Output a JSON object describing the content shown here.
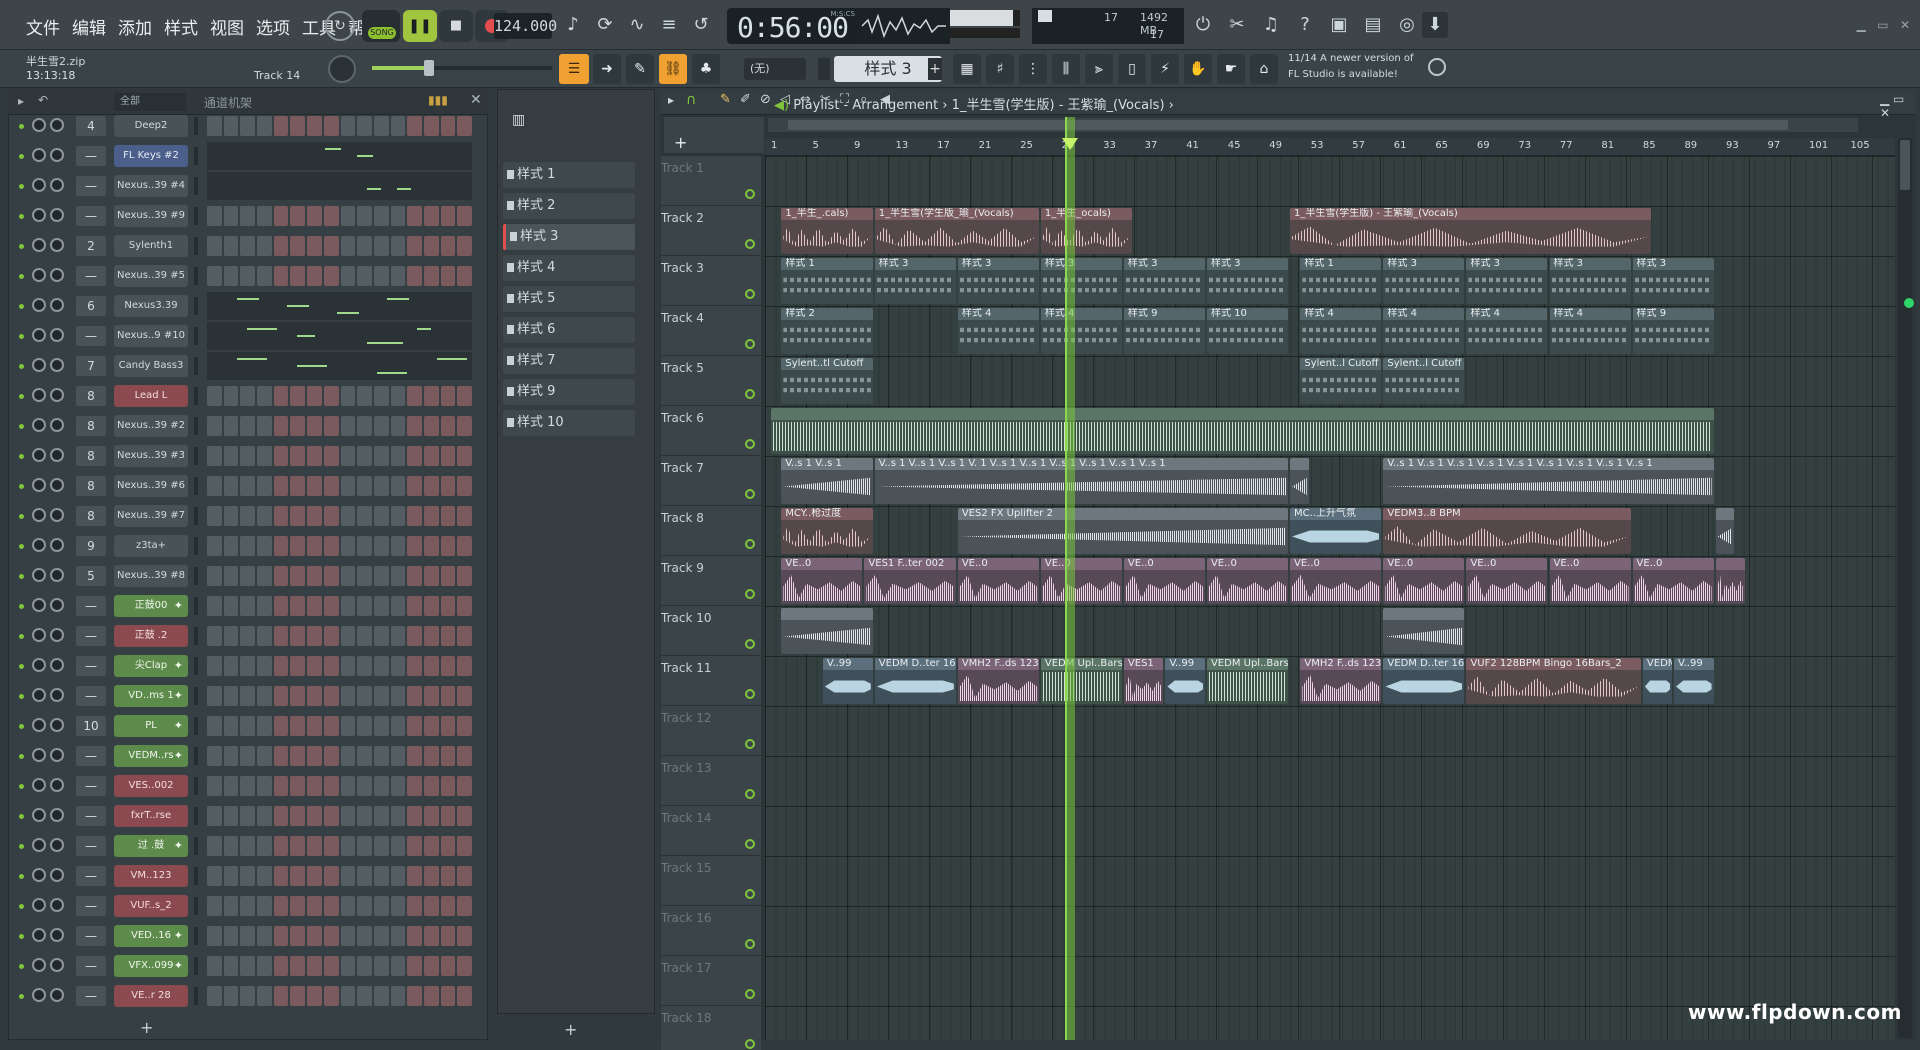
{
  "menu": [
    "文件",
    "编辑",
    "添加",
    "样式",
    "视图",
    "选项",
    "工具",
    "帮助"
  ],
  "transport": {
    "song_label": "SONG",
    "tempo": "124.000",
    "time": "0:56:00",
    "time_unit": "M:S:CS",
    "cpu_value": "17",
    "memory": "1492 MB",
    "polyphony": "17"
  },
  "project": {
    "file": "半生雪2.zip",
    "time": "13:13:18",
    "track_hint": "Track 14"
  },
  "toolbar2": {
    "preset": "(无)",
    "pattern": "样式 3"
  },
  "news": {
    "line1": "11/14  A newer version of",
    "line2": "FL Studio is available!"
  },
  "rack": {
    "filter": "全部",
    "title": "通道机架",
    "channels": [
      {
        "num": "4",
        "name": "Deep2",
        "style": "plain"
      },
      {
        "num": "—",
        "name": "FL Keys #2",
        "style": "blue"
      },
      {
        "num": "—",
        "name": "Nexus..39 #4",
        "style": "plain"
      },
      {
        "num": "—",
        "name": "Nexus..39 #9",
        "style": "plain"
      },
      {
        "num": "2",
        "name": "Sylenth1",
        "style": "plain"
      },
      {
        "num": "—",
        "name": "Nexus..39 #5",
        "style": "plain"
      },
      {
        "num": "6",
        "name": "Nexus3.39",
        "style": "plain"
      },
      {
        "num": "—",
        "name": "Nexus..9 #10",
        "style": "plain"
      },
      {
        "num": "7",
        "name": "Candy Bass3",
        "style": "plain"
      },
      {
        "num": "8",
        "name": "Lead L",
        "style": "red"
      },
      {
        "num": "8",
        "name": "Nexus..39 #2",
        "style": "plain"
      },
      {
        "num": "8",
        "name": "Nexus..39 #3",
        "style": "plain"
      },
      {
        "num": "8",
        "name": "Nexus..39 #6",
        "style": "plain"
      },
      {
        "num": "8",
        "name": "Nexus..39 #7",
        "style": "plain"
      },
      {
        "num": "9",
        "name": "z3ta+",
        "style": "plain"
      },
      {
        "num": "5",
        "name": "Nexus..39 #8",
        "style": "plain"
      },
      {
        "num": "—",
        "name": "正鼓00",
        "style": "green"
      },
      {
        "num": "—",
        "name": "正鼓 .2",
        "style": "red"
      },
      {
        "num": "—",
        "name": "尖Clap",
        "style": "green"
      },
      {
        "num": "—",
        "name": "VD..ms 1",
        "style": "green"
      },
      {
        "num": "10",
        "name": "PL",
        "style": "green"
      },
      {
        "num": "—",
        "name": "VEDM..rs",
        "style": "green"
      },
      {
        "num": "—",
        "name": "VES..002",
        "style": "red"
      },
      {
        "num": "—",
        "name": "fxrT..rse",
        "style": "red"
      },
      {
        "num": "—",
        "name": "过 .鼓",
        "style": "green"
      },
      {
        "num": "—",
        "name": "VM..123",
        "style": "red"
      },
      {
        "num": "—",
        "name": "VUF..s_2",
        "style": "red"
      },
      {
        "num": "—",
        "name": "VED..16",
        "style": "green"
      },
      {
        "num": "—",
        "name": "VFX..099",
        "style": "green"
      },
      {
        "num": "—",
        "name": "VE..r 28",
        "style": "red"
      }
    ]
  },
  "patterns": [
    "样式 1",
    "样式 2",
    "样式 3",
    "样式 4",
    "样式 5",
    "样式 6",
    "样式 7",
    "样式 9",
    "样式 10"
  ],
  "playlist": {
    "title": "Playlist - Arrangement",
    "breadcrumb": "1_半生雪(学生版) - 王紫瑜_(Vocals)",
    "bars": [
      "1",
      "5",
      "9",
      "13",
      "17",
      "21",
      "25",
      "29",
      "33",
      "37",
      "41",
      "45",
      "49",
      "53",
      "57",
      "61",
      "65",
      "69",
      "73",
      "77",
      "81",
      "85",
      "89",
      "93",
      "97",
      "101",
      "105"
    ],
    "tracks": [
      "Track 1",
      "Track 2",
      "Track 3",
      "Track 4",
      "Track 5",
      "Track 6",
      "Track 7",
      "Track 8",
      "Track 9",
      "Track 10",
      "Track 11",
      "Track 12",
      "Track 13",
      "Track 14",
      "Track 15",
      "Track 16",
      "Track 17",
      "Track 18"
    ]
  },
  "clips": [
    {
      "track": 1,
      "start": 1,
      "len": 9,
      "label": "1_半生_.cals)",
      "kind": "audio-r"
    },
    {
      "track": 1,
      "start": 10,
      "len": 16,
      "label": "1_半生雪(学生版_瑜_(Vocals)",
      "kind": "audio-r"
    },
    {
      "track": 1,
      "start": 26,
      "len": 9,
      "label": "1_半生_ocals)",
      "kind": "audio-r"
    },
    {
      "track": 1,
      "start": 50,
      "len": 35,
      "label": "1_半生雪(学生版) - 王紫瑜_(Vocals)",
      "kind": "audio-r"
    },
    {
      "track": 2,
      "start": 1,
      "len": 9,
      "label": "样式 1",
      "kind": "pattern-c"
    },
    {
      "track": 2,
      "start": 10,
      "len": 8,
      "label": "样式 3",
      "kind": "pattern-c"
    },
    {
      "track": 2,
      "start": 18,
      "len": 8,
      "label": "样式 3",
      "kind": "pattern-c"
    },
    {
      "track": 2,
      "start": 26,
      "len": 8,
      "label": "样式 3",
      "kind": "pattern-c"
    },
    {
      "track": 2,
      "start": 34,
      "len": 8,
      "label": "样式 3",
      "kind": "pattern-c"
    },
    {
      "track": 2,
      "start": 42,
      "len": 8,
      "label": "样式 3",
      "kind": "pattern-c"
    },
    {
      "track": 2,
      "start": 51,
      "len": 8,
      "label": "样式 1",
      "kind": "pattern-c"
    },
    {
      "track": 2,
      "start": 59,
      "len": 8,
      "label": "样式 3",
      "kind": "pattern-c"
    },
    {
      "track": 2,
      "start": 67,
      "len": 8,
      "label": "样式 3",
      "kind": "pattern-c"
    },
    {
      "track": 2,
      "start": 75,
      "len": 8,
      "label": "样式 3",
      "kind": "pattern-c"
    },
    {
      "track": 2,
      "start": 83,
      "len": 8,
      "label": "样式 3",
      "kind": "pattern-c"
    },
    {
      "track": 3,
      "start": 1,
      "len": 9,
      "label": "样式 2",
      "kind": "pattern-c"
    },
    {
      "track": 3,
      "start": 18,
      "len": 8,
      "label": "样式 4",
      "kind": "pattern-c"
    },
    {
      "track": 3,
      "start": 26,
      "len": 8,
      "label": "样式 4",
      "kind": "pattern-c"
    },
    {
      "track": 3,
      "start": 34,
      "len": 8,
      "label": "样式 9",
      "kind": "pattern-c"
    },
    {
      "track": 3,
      "start": 42,
      "len": 8,
      "label": "样式 10",
      "kind": "pattern-c"
    },
    {
      "track": 3,
      "start": 51,
      "len": 8,
      "label": "样式 4",
      "kind": "pattern-c"
    },
    {
      "track": 3,
      "start": 59,
      "len": 8,
      "label": "样式 4",
      "kind": "pattern-c"
    },
    {
      "track": 3,
      "start": 67,
      "len": 8,
      "label": "样式 4",
      "kind": "pattern-c"
    },
    {
      "track": 3,
      "start": 75,
      "len": 8,
      "label": "样式 4",
      "kind": "pattern-c"
    },
    {
      "track": 3,
      "start": 83,
      "len": 8,
      "label": "样式 9",
      "kind": "pattern-c"
    },
    {
      "track": 4,
      "start": 1,
      "len": 9,
      "label": "Sylent..tl Cutoff",
      "kind": "pattern-c"
    },
    {
      "track": 4,
      "start": 51,
      "len": 8,
      "label": "Sylent..l Cutoff",
      "kind": "pattern-c"
    },
    {
      "track": 4,
      "start": 59,
      "len": 8,
      "label": "Sylent..l Cutoff",
      "kind": "pattern-c"
    },
    {
      "track": 5,
      "start": 0,
      "len": 91,
      "label": "",
      "kind": "audio-g"
    },
    {
      "track": 6,
      "start": 1,
      "len": 9,
      "label": "V..s 1  V..s 1",
      "kind": "audio-b"
    },
    {
      "track": 6,
      "start": 10,
      "len": 40,
      "label": "V..s 1  V..s 1  V..s 1  V. 1  V..s 1  V..s 1  V..s 1  V..s 1  V..s 1  V..s 1",
      "kind": "audio-b"
    },
    {
      "track": 6,
      "start": 50,
      "len": 2,
      "label": "",
      "kind": "audio-b"
    },
    {
      "track": 6,
      "start": 59,
      "len": 32,
      "label": "V..s 1  V..s 1  V..s 1  V..s 1  V..s 1  V..s 1  V..s 1  V..s 1  V..s 1",
      "kind": "audio-b"
    },
    {
      "track": 7,
      "start": 1,
      "len": 9,
      "label": "MCY..枪过度",
      "kind": "audio-r"
    },
    {
      "track": 7,
      "start": 18,
      "len": 32,
      "label": "VES2 FX Uplifter 2",
      "kind": "audio-b"
    },
    {
      "track": 7,
      "start": 50,
      "len": 9,
      "label": "MC..上升气氛",
      "kind": "audio-c"
    },
    {
      "track": 7,
      "start": 59,
      "len": 24,
      "label": "VEDM3..8 BPM",
      "kind": "audio-r"
    },
    {
      "track": 7,
      "start": 91,
      "len": 2,
      "label": "",
      "kind": "audio-b"
    },
    {
      "track": 8,
      "start": 1,
      "len": 8,
      "label": "VE..0",
      "kind": "audio-p"
    },
    {
      "track": 8,
      "start": 9,
      "len": 9,
      "label": "VES1 F..ter 002",
      "kind": "audio-p"
    },
    {
      "track": 8,
      "start": 18,
      "len": 8,
      "label": "VE..0",
      "kind": "audio-p"
    },
    {
      "track": 8,
      "start": 26,
      "len": 8,
      "label": "VE..0",
      "kind": "audio-p"
    },
    {
      "track": 8,
      "start": 34,
      "len": 8,
      "label": "VE..0",
      "kind": "audio-p"
    },
    {
      "track": 8,
      "start": 42,
      "len": 8,
      "label": "VE..0",
      "kind": "audio-p"
    },
    {
      "track": 8,
      "start": 50,
      "len": 9,
      "label": "VE..0",
      "kind": "audio-p"
    },
    {
      "track": 8,
      "start": 59,
      "len": 8,
      "label": "VE..0",
      "kind": "audio-p"
    },
    {
      "track": 8,
      "start": 67,
      "len": 8,
      "label": "VE..0",
      "kind": "audio-p"
    },
    {
      "track": 8,
      "start": 75,
      "len": 8,
      "label": "VE..0",
      "kind": "audio-p"
    },
    {
      "track": 8,
      "start": 83,
      "len": 8,
      "label": "VE..0",
      "kind": "audio-p"
    },
    {
      "track": 8,
      "start": 91,
      "len": 3,
      "label": "",
      "kind": "audio-p"
    },
    {
      "track": 9,
      "start": 1,
      "len": 9,
      "label": "",
      "kind": "audio-b"
    },
    {
      "track": 9,
      "start": 59,
      "len": 8,
      "label": "",
      "kind": "audio-b"
    },
    {
      "track": 10,
      "start": 5,
      "len": 5,
      "label": "V..99",
      "kind": "audio-c"
    },
    {
      "track": 10,
      "start": 10,
      "len": 8,
      "label": "VEDM D..ter 16",
      "kind": "audio-c"
    },
    {
      "track": 10,
      "start": 18,
      "len": 8,
      "label": "VMH2 F..ds 123",
      "kind": "audio-p"
    },
    {
      "track": 10,
      "start": 26,
      "len": 8,
      "label": "VEDM Upl..Bars",
      "kind": "audio-g"
    },
    {
      "track": 10,
      "start": 34,
      "len": 4,
      "label": "VES1",
      "kind": "audio-p"
    },
    {
      "track": 10,
      "start": 38,
      "len": 4,
      "label": "V..99",
      "kind": "audio-c"
    },
    {
      "track": 10,
      "start": 42,
      "len": 8,
      "label": "VEDM Upl..Bars",
      "kind": "audio-g"
    },
    {
      "track": 10,
      "start": 51,
      "len": 8,
      "label": "VMH2 F..ds 123",
      "kind": "audio-p"
    },
    {
      "track": 10,
      "start": 59,
      "len": 8,
      "label": "VEDM D..ter 16",
      "kind": "audio-c"
    },
    {
      "track": 10,
      "start": 67,
      "len": 17,
      "label": "VUF2 128BPM Bingo 16Bars_2",
      "kind": "audio-r"
    },
    {
      "track": 10,
      "start": 84,
      "len": 3,
      "label": "VEDM",
      "kind": "audio-c"
    },
    {
      "track": 10,
      "start": 87,
      "len": 4,
      "label": "V..99",
      "kind": "audio-c"
    }
  ],
  "watermark": "www.flpdown.com"
}
